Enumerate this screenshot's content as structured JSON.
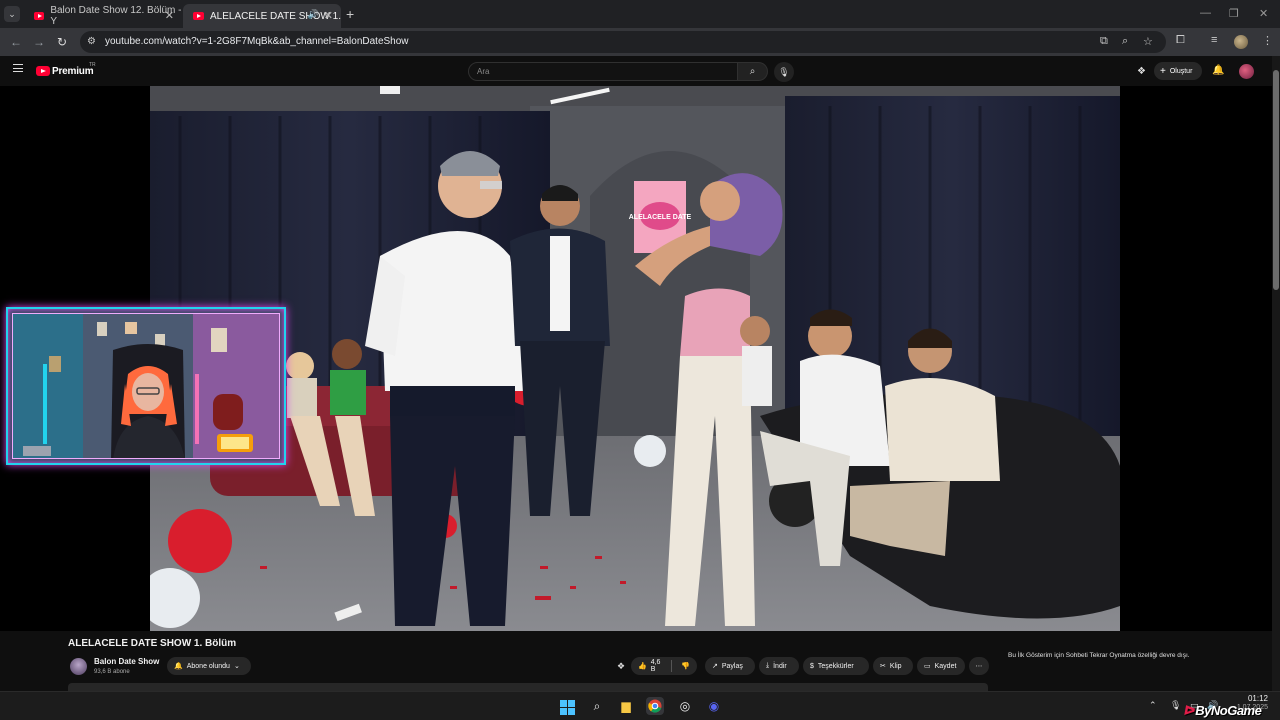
{
  "browser": {
    "tabs": [
      {
        "title": "Balon Date Show 12. Bölüm - Y",
        "close": "✕"
      },
      {
        "title": "ALELACELE DATE SHOW 1.",
        "close": "✕",
        "audio_icon": "speaker-icon"
      }
    ],
    "new_tab": "+",
    "url": "youtube.com/watch?v=1-2G8F7MqBk&ab_channel=BalonDateShow"
  },
  "youtube": {
    "brand": "Premium",
    "country": "TR",
    "search_placeholder": "Ara",
    "create_label": "Oluştur"
  },
  "video": {
    "title": "ALELACELE DATE SHOW 1. Bölüm",
    "channel_name": "Balon Date Show",
    "subscribers": "93,6 B abone",
    "subscribe_label": "Abone olundu",
    "likes": "4,6 B",
    "actions": {
      "share": "Paylaş",
      "download": "İndir",
      "thanks": "Teşekkürler",
      "clip": "Klip",
      "save": "Kaydet",
      "more": "⋯"
    },
    "chat_note": "Bu İlk Gösterim için Sohbeti Tekrar Oynatma özelliği devre dışı.",
    "poster_text": "ALELACELE DATE"
  },
  "taskbar": {
    "time": "01:12",
    "date": "1.07.2025"
  },
  "watermark": "ByNoGame",
  "colors": {
    "youtube_red": "#ff0033",
    "webcam_border": "#22d3ee",
    "webcam_glow": "#d946ef"
  }
}
